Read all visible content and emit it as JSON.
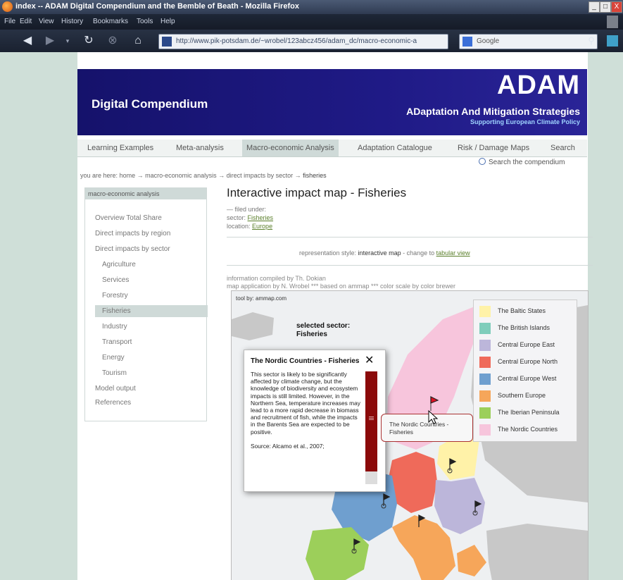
{
  "window": {
    "title": "index -- ADAM Digital Compendium and the Bemble of Beath - Mozilla Firefox",
    "controls": [
      "_",
      "□",
      "X"
    ]
  },
  "menu": [
    "File",
    "Edit",
    "View",
    "History",
    "Bookmarks",
    "Tools",
    "Help"
  ],
  "nav": {
    "url": "http://www.pik-potsdam.de/~wrobel/123abcz456/adam_dc/macro-economic-a",
    "search_placeholder": "Google"
  },
  "banner": {
    "left_title": "Digital Compendium",
    "logo": "ADAM",
    "subtitle": "ADaptation And Mitigation Strategies",
    "tagline": "Supporting European Climate Policy"
  },
  "tabs": [
    {
      "label": "Learning Examples",
      "active": false
    },
    {
      "label": "Meta-analysis",
      "active": false
    },
    {
      "label": "Macro-economic Analysis",
      "active": true
    },
    {
      "label": "Adaptation Catalogue",
      "active": false
    },
    {
      "label": "Risk / Damage Maps",
      "active": false
    },
    {
      "label": "Search",
      "active": false
    }
  ],
  "search_compendium": "Search the compendium",
  "breadcrumb": {
    "prefix": "you are here:",
    "path": "home → macro-economic analysis → direct impacts by sector →",
    "current": "fisheries"
  },
  "leftnav": {
    "header": "macro-economic analysis",
    "items": [
      {
        "label": "Overview Total Share",
        "level": 0,
        "selected": false
      },
      {
        "label": "Direct impacts by region",
        "level": 0,
        "selected": false
      },
      {
        "label": "Direct impacts by sector",
        "level": 0,
        "selected": false
      },
      {
        "label": "Agriculture",
        "level": 1,
        "selected": false
      },
      {
        "label": "Services",
        "level": 1,
        "selected": false
      },
      {
        "label": "Forestry",
        "level": 1,
        "selected": false
      },
      {
        "label": "Fisheries",
        "level": 1,
        "selected": true
      },
      {
        "label": "Industry",
        "level": 1,
        "selected": false
      },
      {
        "label": "Transport",
        "level": 1,
        "selected": false
      },
      {
        "label": "Energy",
        "level": 1,
        "selected": false
      },
      {
        "label": "Tourism",
        "level": 1,
        "selected": false
      },
      {
        "label": "Model output",
        "level": 0,
        "selected": false
      },
      {
        "label": "References",
        "level": 0,
        "selected": false
      }
    ]
  },
  "content": {
    "title": "Interactive impact map - Fisheries",
    "filed_under": "— filed under:",
    "sector_label": "sector:",
    "sector_value": "Fisheries",
    "location_label": "location:",
    "location_value": "Europe",
    "rep_prefix": "representation style:",
    "rep_current": "interactive map",
    "rep_change": "- change to",
    "rep_link": "tabular view",
    "info_line1": "information compiled by Th. Dokian",
    "info_line2": "map application by N. Wrobel *** based on ammap *** color scale by color brewer"
  },
  "map": {
    "tool_by": "tool by: ammap.com",
    "selected_sector_label": "selected sector:",
    "selected_sector_value": "Fisheries",
    "legend": [
      {
        "label": "The Baltic States",
        "color": "#fff2a8"
      },
      {
        "label": "The British Islands",
        "color": "#7fcdbb"
      },
      {
        "label": "Central Europe East",
        "color": "#bcb6da"
      },
      {
        "label": "Central Europe North",
        "color": "#ef6a5a"
      },
      {
        "label": "Central Europe West",
        "color": "#6f9fcf"
      },
      {
        "label": "Southern Europe",
        "color": "#f6a65a"
      },
      {
        "label": "The Iberian Peninsula",
        "color": "#9ccf5a"
      },
      {
        "label": "The Nordic Countries",
        "color": "#f7c5dc"
      }
    ],
    "popup": {
      "title": "The Nordic Countries - Fisheries",
      "body": "This sector is likely to be significantly affected by climate change, but the knowledge of biodiversity and ecosystem impacts is still limited. However, in the Northern Sea, temperature increases may lead to a more rapid decrease in biomass and recruitment of fish, while the impacts in the Barents Sea are expected to be positive.",
      "source": "Source: Alcamo et al., 2007;"
    },
    "tooltip_line1": "The Nordic Countries -",
    "tooltip_line2": "Fisheries"
  }
}
